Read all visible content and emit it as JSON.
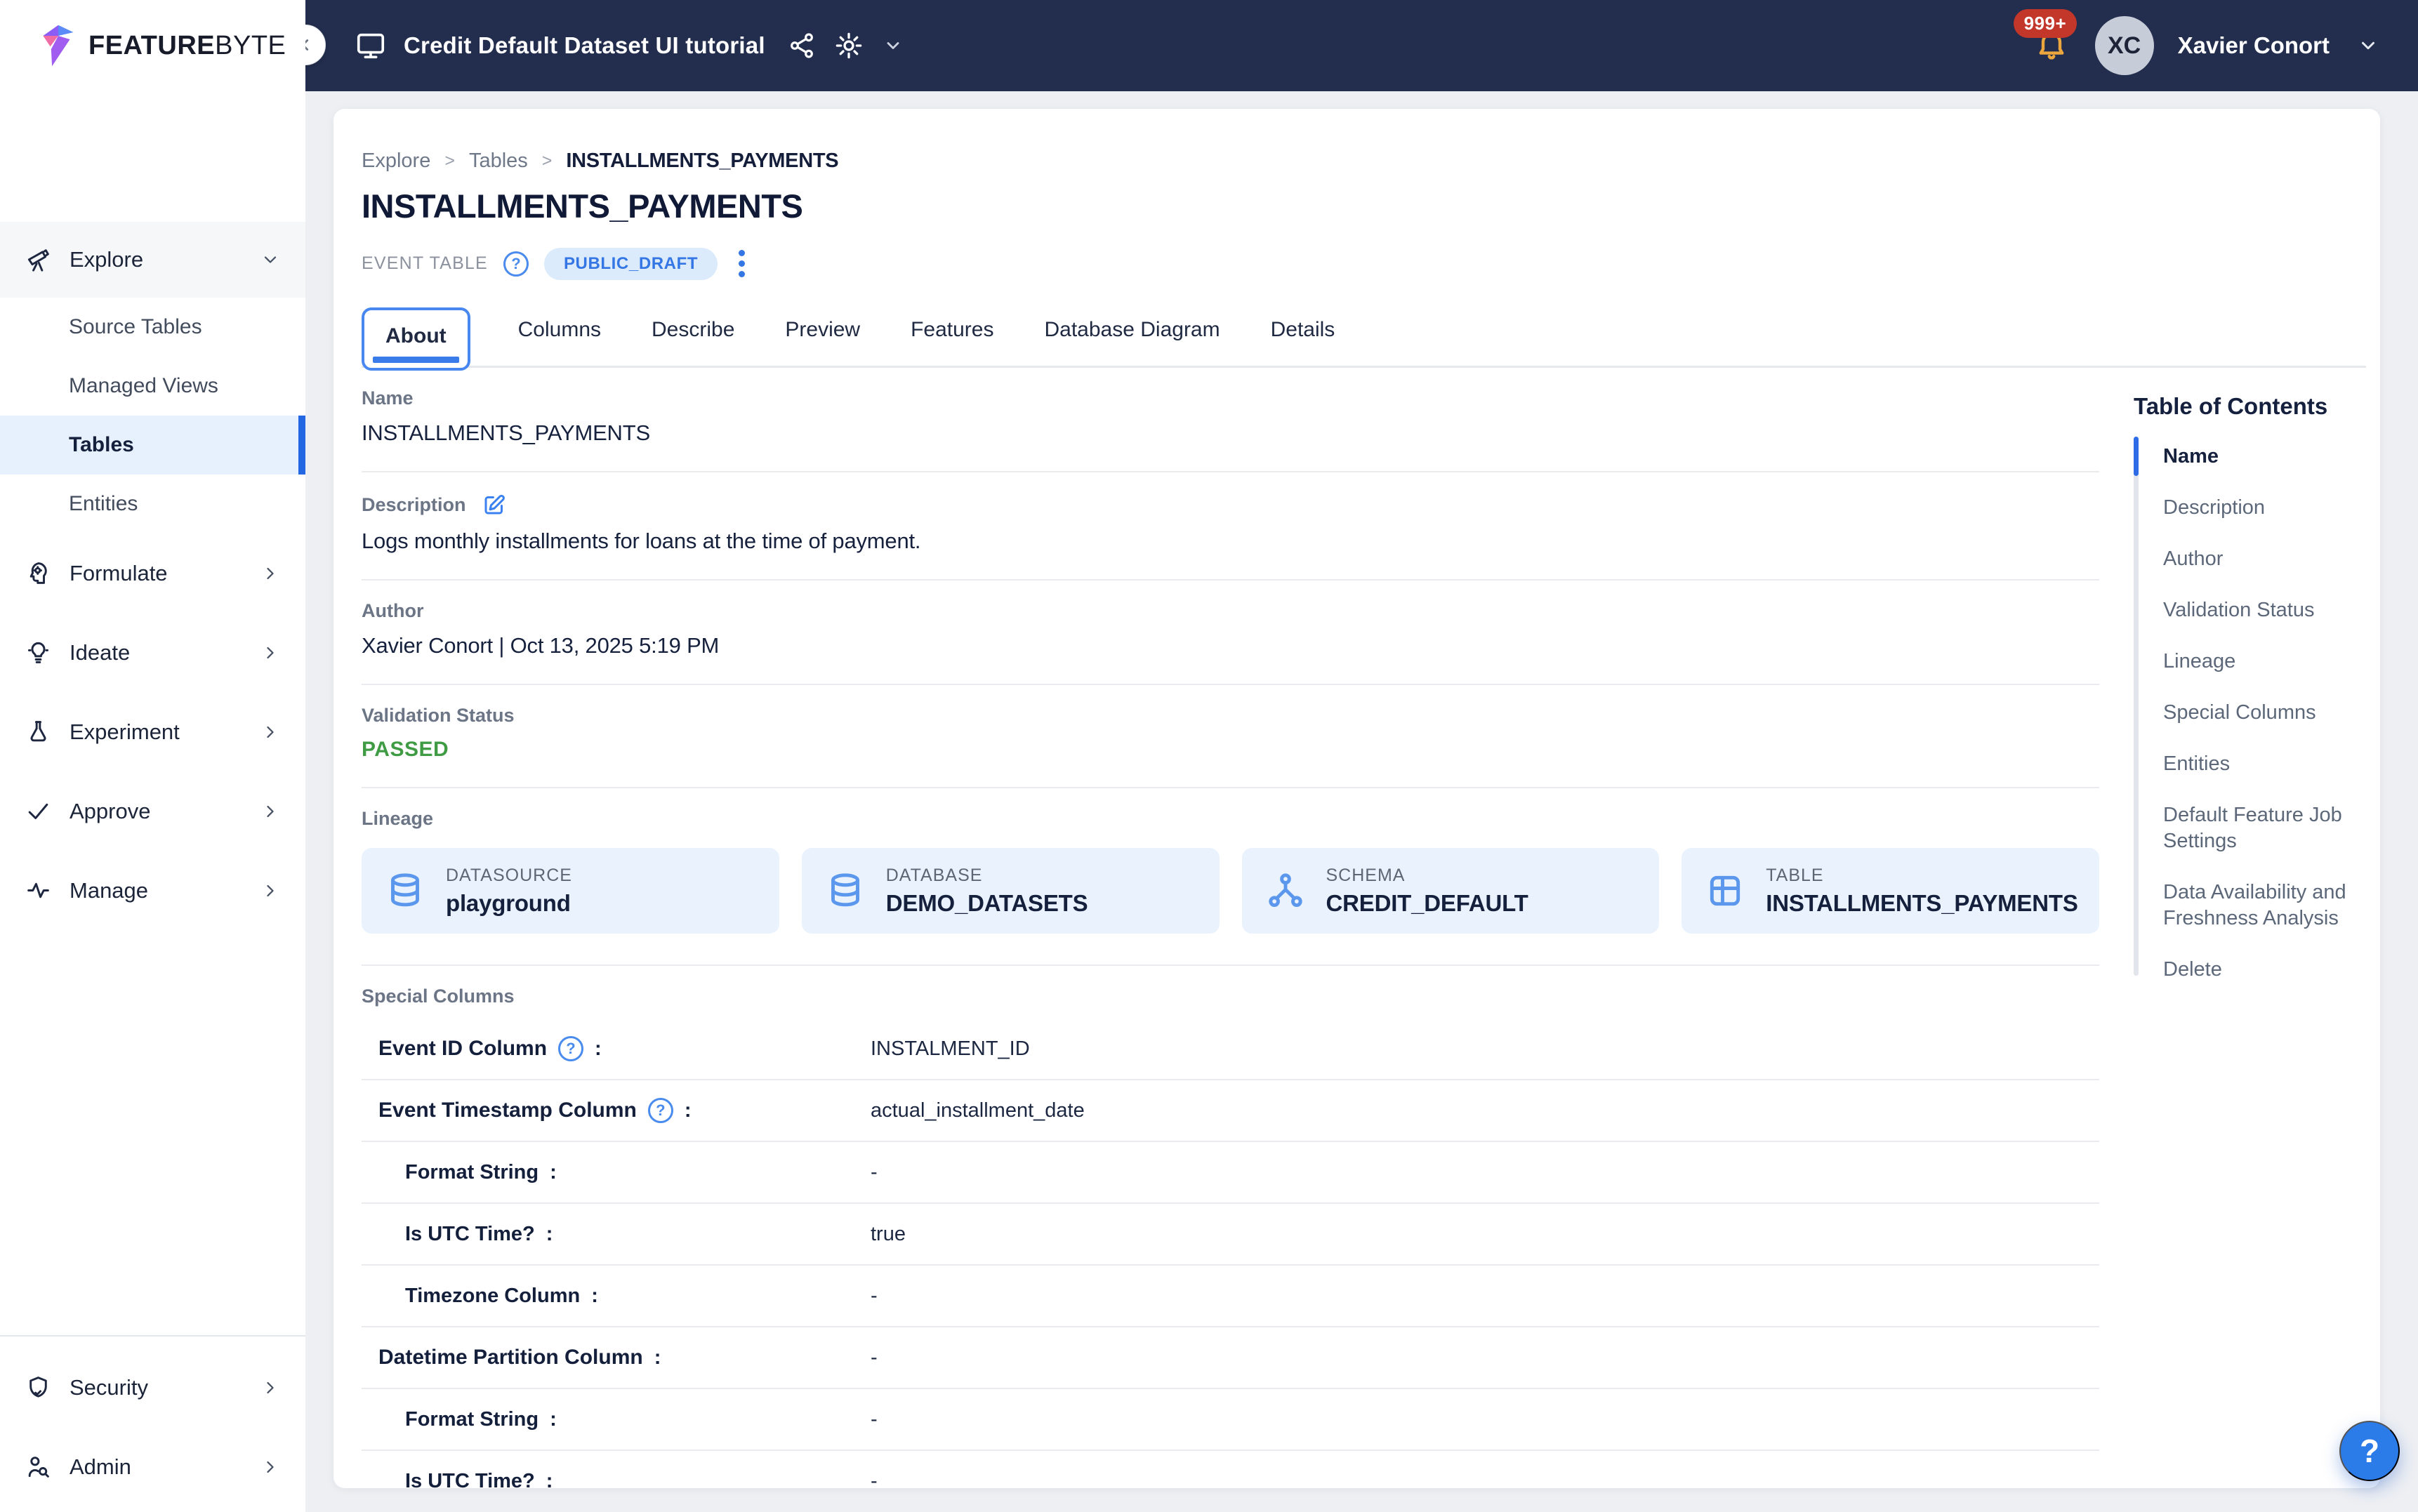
{
  "brand": {
    "name_bold": "FEATURE",
    "name_light": "BYTE"
  },
  "topbar": {
    "workspace_title": "Credit Default Dataset UI tutorial",
    "notification_count": "999+",
    "user_initials": "XC",
    "user_name": "Xavier Conort"
  },
  "sidebar": {
    "groups": [
      {
        "label": "Explore"
      },
      {
        "label": "Formulate"
      },
      {
        "label": "Ideate"
      },
      {
        "label": "Experiment"
      },
      {
        "label": "Approve"
      },
      {
        "label": "Manage"
      }
    ],
    "explore_items": [
      {
        "label": "Source Tables"
      },
      {
        "label": "Managed Views"
      },
      {
        "label": "Tables"
      },
      {
        "label": "Entities"
      }
    ],
    "selected_item": "Tables",
    "footer": [
      {
        "label": "Security"
      },
      {
        "label": "Admin"
      }
    ]
  },
  "page": {
    "breadcrumb": [
      "Explore",
      "Tables",
      "INSTALLMENTS_PAYMENTS"
    ],
    "breadcrumb_separator": ">",
    "title": "INSTALLMENTS_PAYMENTS",
    "type_label": "EVENT TABLE",
    "status_badge": "PUBLIC_DRAFT",
    "help_glyph": "?",
    "tabs": [
      {
        "label": "About"
      },
      {
        "label": "Columns"
      },
      {
        "label": "Describe"
      },
      {
        "label": "Preview"
      },
      {
        "label": "Features"
      },
      {
        "label": "Database Diagram"
      },
      {
        "label": "Details"
      }
    ],
    "active_tab": "About"
  },
  "about": {
    "name": {
      "label": "Name",
      "value": "INSTALLMENTS_PAYMENTS"
    },
    "description": {
      "label": "Description",
      "value": "Logs monthly installments for loans at the time of payment."
    },
    "author": {
      "label": "Author",
      "value": "Xavier Conort | Oct 13, 2025 5:19 PM"
    },
    "validation": {
      "label": "Validation Status",
      "value": "PASSED"
    },
    "lineage": {
      "label": "Lineage",
      "cards": [
        {
          "type": "DATASOURCE",
          "value": "playground",
          "icon": "database-icon"
        },
        {
          "type": "DATABASE",
          "value": "DEMO_DATASETS",
          "icon": "database-icon"
        },
        {
          "type": "SCHEMA",
          "value": "CREDIT_DEFAULT",
          "icon": "schema-icon"
        },
        {
          "type": "TABLE",
          "value": "INSTALLMENTS_PAYMENTS",
          "icon": "table-icon"
        }
      ]
    },
    "special_columns": {
      "label": "Special Columns",
      "colon": ":",
      "rows": [
        {
          "label": "Event ID Column",
          "value": "INSTALMENT_ID",
          "level": 0,
          "help": true
        },
        {
          "label": "Event Timestamp Column",
          "value": "actual_installment_date",
          "level": 0,
          "help": true
        },
        {
          "label": "Format String",
          "value": "-",
          "level": 1,
          "help": false
        },
        {
          "label": "Is UTC Time?",
          "value": "true",
          "level": 1,
          "help": false
        },
        {
          "label": "Timezone Column",
          "value": "-",
          "level": 1,
          "help": false
        },
        {
          "label": "Datetime Partition Column",
          "value": "-",
          "level": 0,
          "help": false
        },
        {
          "label": "Format String",
          "value": "-",
          "level": 1,
          "help": false
        },
        {
          "label": "Is UTC Time?",
          "value": "-",
          "level": 1,
          "help": false
        }
      ]
    }
  },
  "toc": {
    "title": "Table of Contents",
    "active": "Name",
    "items": [
      {
        "label": "Name"
      },
      {
        "label": "Description"
      },
      {
        "label": "Author"
      },
      {
        "label": "Validation Status"
      },
      {
        "label": "Lineage"
      },
      {
        "label": "Special Columns"
      },
      {
        "label": "Entities"
      },
      {
        "label": "Default Feature Job Settings"
      },
      {
        "label": "Data Availability and Freshness Analysis"
      },
      {
        "label": "Delete"
      }
    ]
  },
  "help_button": "?",
  "colors": {
    "topbar_bg": "#232d4d",
    "accent_blue": "#2e6be7",
    "badge_bg": "#dcebfb",
    "badge_text": "#3376e4",
    "passed_green": "#3f9b44",
    "notification_red": "#c3372b",
    "bell_amber": "#eca63e",
    "selected_item_bg": "#e7f1fd",
    "lineage_card_bg": "#e9f2fd",
    "page_bg": "#edeff3"
  }
}
